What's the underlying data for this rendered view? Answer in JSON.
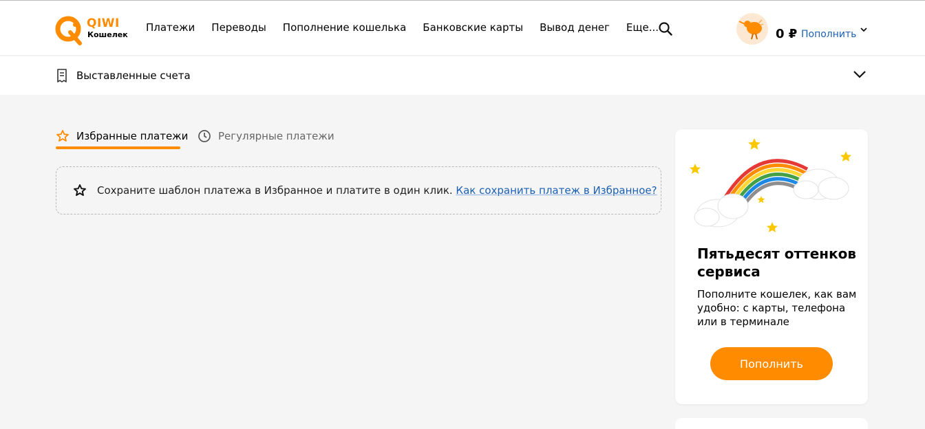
{
  "brand": {
    "name": "QIWI",
    "subtitle": "Кошелек",
    "accent": "#ff8c00",
    "link_color": "#1a5fb4"
  },
  "nav": {
    "items": [
      {
        "label": "Платежи"
      },
      {
        "label": "Переводы"
      },
      {
        "label": "Пополнение кошелька"
      },
      {
        "label": "Банковские карты"
      },
      {
        "label": "Вывод денег"
      },
      {
        "label": "Еще..."
      }
    ],
    "search_icon": "search-icon"
  },
  "account": {
    "balance": "0 ₽",
    "topup_label": "Пополнить",
    "avatar_icon": "kiwi-bird-icon"
  },
  "subbar": {
    "label": "Выставленные счета",
    "icon": "receipt-icon"
  },
  "tabs": [
    {
      "label": "Избранные платежи",
      "icon": "star-icon",
      "active": true
    },
    {
      "label": "Регулярные платежи",
      "icon": "clock-icon",
      "active": false
    }
  ],
  "hint": {
    "text": "Сохраните шаблон платежа в Избранное и платите в один клик. ",
    "link": "Как сохранить платеж в Избранное?"
  },
  "promo": {
    "title": "Пятьдесят оттенков сервиса",
    "description": "Пополните кошелек, как вам удобно: с карты, телефона или в терминале",
    "button_label": "Пополнить",
    "art_icon": "rainbow-illustration"
  }
}
